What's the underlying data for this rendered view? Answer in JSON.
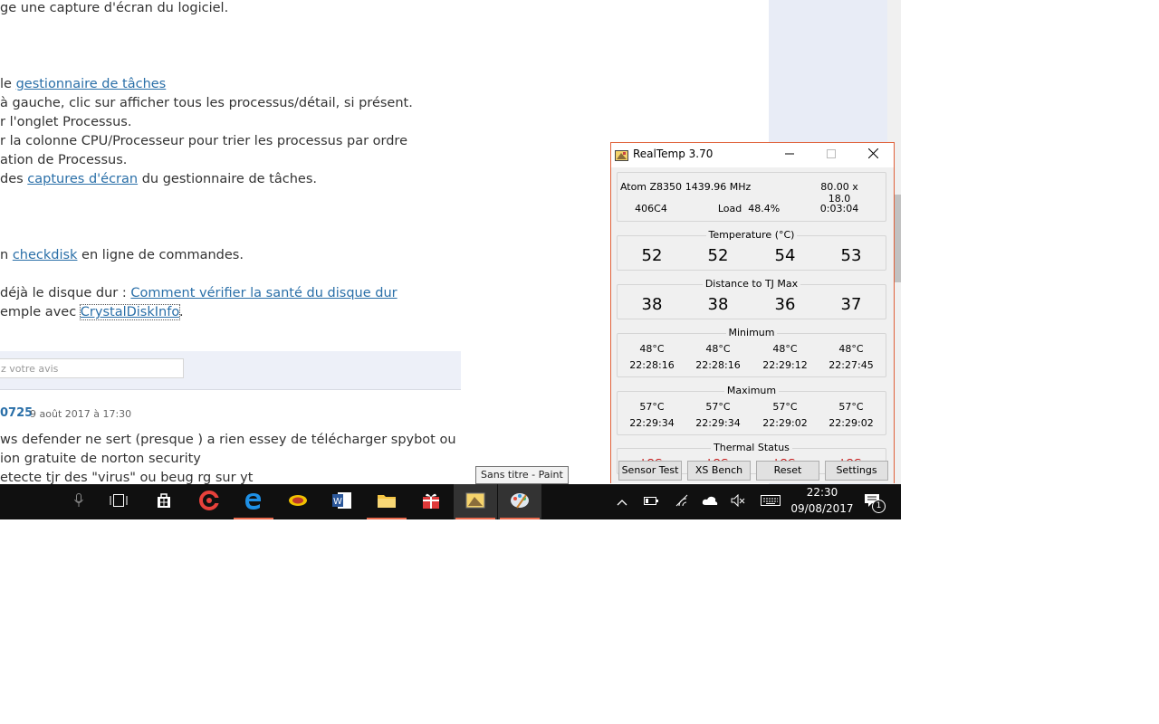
{
  "article": {
    "line1": "ge une capture d'écran du logiciel.",
    "line2_prefix": "le ",
    "line2_link": "gestionnaire de tâches",
    "line3": "à gauche, clic sur afficher tous les processus/détail, si présent.",
    "line4": "r l'onglet Processus.",
    "line5": "r la colonne CPU/Processeur pour trier les processus par ordre",
    "line6": "ation de Processus.",
    "line7_prefix": "des ",
    "line7_link": "captures d'écran",
    "line7_suffix": " du gestionnaire de tâches.",
    "line8_prefix": "n ",
    "line8_link": "checkdisk",
    "line8_suffix": " en ligne de commandes.",
    "line9_prefix": " déjà le disque dur : ",
    "line9_link": "Comment vérifier la santé du disque dur",
    "line10_prefix": "emple avec ",
    "line10_link": "CrystalDiskInfo",
    "line10_suffix": "."
  },
  "comment_box": {
    "placeholder": "z votre avis"
  },
  "comment": {
    "author": "0725",
    "date": "9 août 2017 à 17:30",
    "line1": "ws defender ne sert (presque ) a rien essey de télécharger spybot ou",
    "line2": "ion gratuite de norton security",
    "line3": "etecte tjr des \"virus\" ou beug rg sur yt"
  },
  "tooltip": "Sans titre - Paint",
  "realtemp": {
    "title": "RealTemp 3.70",
    "cpu_model": "Atom Z8350",
    "frequency": "1439.96 MHz",
    "multiplier": "80.00 x 18.0",
    "cpuid": "406C4",
    "load_label": "Load",
    "load_value": "48.4%",
    "uptime": "0:03:04",
    "temperature_label": "Temperature (°C)",
    "temperatures": [
      "52",
      "52",
      "54",
      "53"
    ],
    "distance_label": "Distance to TJ Max",
    "distances": [
      "38",
      "38",
      "36",
      "37"
    ],
    "minimum_label": "Minimum",
    "minimum_temps": [
      "48°C",
      "48°C",
      "48°C",
      "48°C"
    ],
    "minimum_times": [
      "22:28:16",
      "22:28:16",
      "22:29:12",
      "22:27:45"
    ],
    "maximum_label": "Maximum",
    "maximum_temps": [
      "57°C",
      "57°C",
      "57°C",
      "57°C"
    ],
    "maximum_times": [
      "22:29:34",
      "22:29:34",
      "22:29:02",
      "22:29:02"
    ],
    "thermal_label": "Thermal Status",
    "thermal_status": [
      "LOG",
      "LOG",
      "LOG",
      "LOG"
    ],
    "buttons": [
      "Sensor Test",
      "XS Bench",
      "Reset",
      "Settings"
    ]
  },
  "taskbar": {
    "time": "22:30",
    "date": "09/08/2017",
    "notification_count": "1",
    "accent_color": "#e96a4d"
  }
}
